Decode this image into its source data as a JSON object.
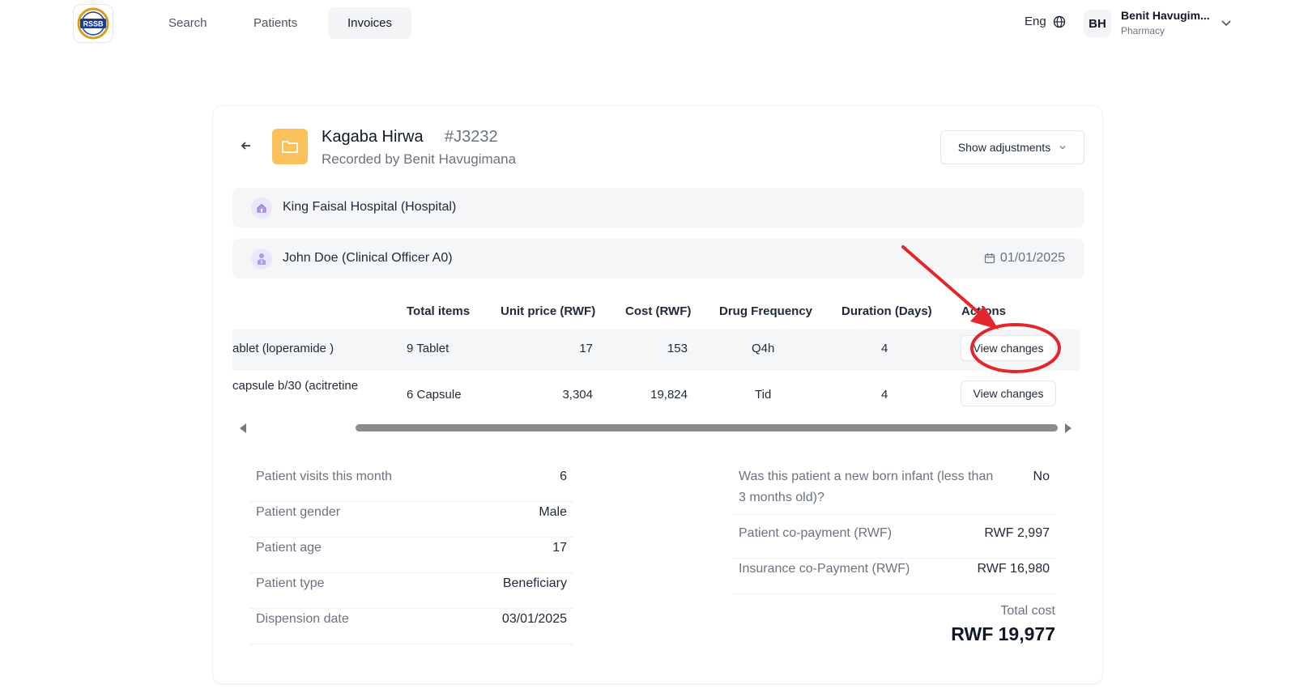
{
  "nav": {
    "logo_text": "RSSB",
    "items": [
      {
        "label": "Search"
      },
      {
        "label": "Patients"
      },
      {
        "label": "Invoices"
      }
    ],
    "language": "Eng",
    "user": {
      "initials": "BH",
      "name": "Benit Havugim...",
      "role": "Pharmacy"
    }
  },
  "invoice": {
    "patient_name": "Kagaba Hirwa",
    "invoice_number": "#J3232",
    "recorded_by": "Recorded by Benit Havugimana",
    "adjustments_label": "Show adjustments",
    "hospital": "King Faisal Hospital (Hospital)",
    "prescriber": "John Doe (Clinical Officer A0)",
    "date": "01/01/2025"
  },
  "table": {
    "headers": [
      "Total items",
      "Unit price (RWF)",
      "Cost (RWF)",
      "Drug Frequency",
      "Duration (Days)",
      "Actions"
    ],
    "rows": [
      {
        "drug": "ablet (loperamide )",
        "total_items": "9 Tablet",
        "unit_price": "17",
        "cost": "153",
        "frequency": "Q4h",
        "duration": "4",
        "action": "View changes"
      },
      {
        "drug": "capsule b/30 (acitretine",
        "total_items": "6 Capsule",
        "unit_price": "3,304",
        "cost": "19,824",
        "frequency": "Tid",
        "duration": "4",
        "action": "View changes"
      }
    ]
  },
  "summary_left": [
    {
      "label": "Patient visits this month",
      "value": "6"
    },
    {
      "label": "Patient gender",
      "value": "Male"
    },
    {
      "label": "Patient age",
      "value": "17"
    },
    {
      "label": "Patient type",
      "value": "Beneficiary"
    },
    {
      "label": "Dispension date",
      "value": "03/01/2025"
    }
  ],
  "summary_right": [
    {
      "label": "Was this patient a new born infant (less than 3 months old)?",
      "value": "No"
    },
    {
      "label": "Patient co-payment (RWF)",
      "value": "RWF 2,997"
    },
    {
      "label": "Insurance co-Payment (RWF)",
      "value": "RWF 16,980"
    }
  ],
  "total": {
    "label": "Total cost",
    "value": "RWF 19,977"
  },
  "colors": {
    "accent_folder": "#f9c25c",
    "annotation_red": "#e3262b",
    "row_bg": "#f5f6f8"
  },
  "icons": [
    "globe-icon",
    "chevron-down-icon",
    "arrow-left-icon",
    "folder-icon",
    "hospital-icon",
    "doctor-icon",
    "calendar-icon"
  ]
}
